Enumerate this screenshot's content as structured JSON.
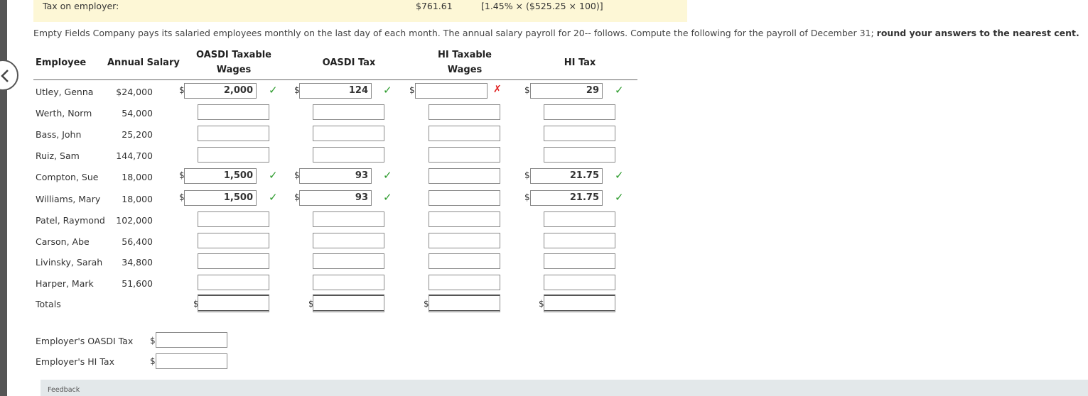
{
  "banner": {
    "label": "Tax on employer:",
    "amount": "$761.61",
    "formula": "[1.45% × ($525.25 × 100)]"
  },
  "intro": {
    "text": "Empty Fields Company pays its salaried employees monthly on the last day of each month. The annual salary payroll for 20-- follows. Compute the following for the payroll of December 31; ",
    "bold": "round your answers to the nearest cent."
  },
  "headers": {
    "employee": "Employee",
    "annual_salary": "Annual Salary",
    "oasdi_wages_1": "OASDI Taxable",
    "oasdi_wages_2": "Wages",
    "oasdi_tax": "OASDI Tax",
    "hi_wages_1": "HI Taxable",
    "hi_wages_2": "Wages",
    "hi_tax": "HI Tax"
  },
  "currency": "$",
  "rows": [
    {
      "name": "Utley, Genna",
      "salary": "$24,000",
      "oasdi_wages": "2,000",
      "oasdi_tax": "124",
      "hi_wages": "",
      "hi_tax": "29",
      "marks": [
        "ok",
        "ok",
        "x",
        "ok"
      ]
    },
    {
      "name": "Werth, Norm",
      "salary": "54,000",
      "oasdi_wages": "",
      "oasdi_tax": "",
      "hi_wages": "",
      "hi_tax": "",
      "marks": [
        "",
        "",
        "",
        ""
      ]
    },
    {
      "name": "Bass, John",
      "salary": "25,200",
      "oasdi_wages": "",
      "oasdi_tax": "",
      "hi_wages": "",
      "hi_tax": "",
      "marks": [
        "",
        "",
        "",
        ""
      ]
    },
    {
      "name": "Ruiz, Sam",
      "salary": "144,700",
      "oasdi_wages": "",
      "oasdi_tax": "",
      "hi_wages": "",
      "hi_tax": "",
      "marks": [
        "",
        "",
        "",
        ""
      ]
    },
    {
      "name": "Compton, Sue",
      "salary": "18,000",
      "oasdi_wages": "1,500",
      "oasdi_tax": "93",
      "hi_wages": "",
      "hi_tax": "21.75",
      "marks": [
        "ok",
        "ok",
        "",
        "ok"
      ]
    },
    {
      "name": "Williams, Mary",
      "salary": "18,000",
      "oasdi_wages": "1,500",
      "oasdi_tax": "93",
      "hi_wages": "",
      "hi_tax": "21.75",
      "marks": [
        "ok",
        "ok",
        "",
        "ok"
      ]
    },
    {
      "name": "Patel, Raymond",
      "salary": "102,000",
      "oasdi_wages": "",
      "oasdi_tax": "",
      "hi_wages": "",
      "hi_tax": "",
      "marks": [
        "",
        "",
        "",
        ""
      ]
    },
    {
      "name": "Carson, Abe",
      "salary": "56,400",
      "oasdi_wages": "",
      "oasdi_tax": "",
      "hi_wages": "",
      "hi_tax": "",
      "marks": [
        "",
        "",
        "",
        ""
      ]
    },
    {
      "name": "Livinsky, Sarah",
      "salary": "34,800",
      "oasdi_wages": "",
      "oasdi_tax": "",
      "hi_wages": "",
      "hi_tax": "",
      "marks": [
        "",
        "",
        "",
        ""
      ]
    },
    {
      "name": "Harper, Mark",
      "salary": "51,600",
      "oasdi_wages": "",
      "oasdi_tax": "",
      "hi_wages": "",
      "hi_tax": "",
      "marks": [
        "",
        "",
        "",
        ""
      ]
    }
  ],
  "totals_label": "Totals",
  "employer": {
    "oasdi_label": "Employer's OASDI Tax",
    "hi_label": "Employer's HI Tax"
  },
  "feedback_label": "Feedback",
  "marks": {
    "ok": "✓",
    "x": "✗"
  },
  "colors": {
    "banner": "#fdf7d6",
    "ok": "#2e9c2e",
    "error": "#e02020",
    "feedback_bar": "#e3e8ea"
  }
}
